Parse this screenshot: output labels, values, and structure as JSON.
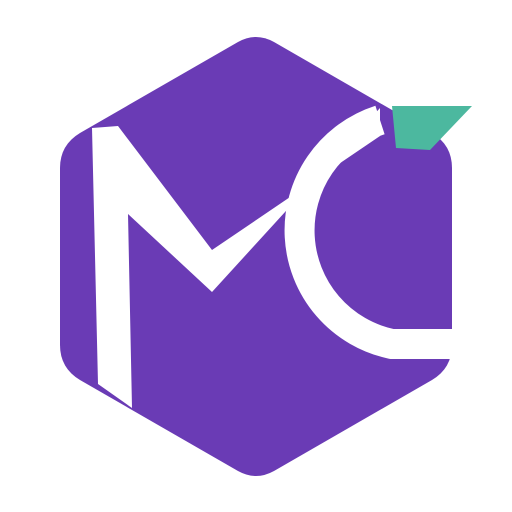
{
  "logo": {
    "name": "mc-hexagon-logo",
    "colors": {
      "background": "#ffffff",
      "hexagon": "#6a3bb5",
      "letters": "#ffffff",
      "accent": "#4cb89f"
    }
  }
}
